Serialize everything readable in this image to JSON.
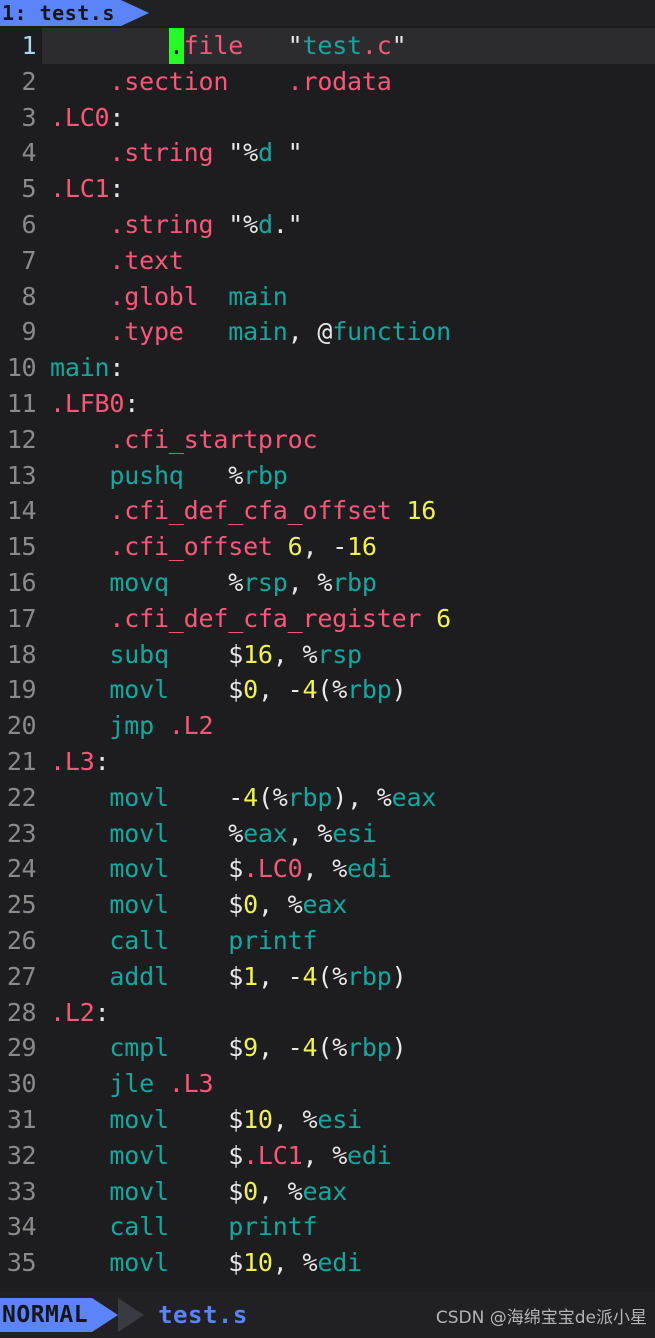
{
  "app": {
    "name": "vim-terminal-editor",
    "background": "#1d1d1f"
  },
  "colors": {
    "accent_blue": "#5c84fa",
    "directive_pink": "#f8567a",
    "identifier_teal": "#12a8a0",
    "number_yellow": "#f2f24f",
    "punctuation_white": "#e8e8e8",
    "cursor_green": "#27fb27",
    "linenr_gray": "#8a8a8a",
    "current_linenr": "#a9d8ef",
    "cursorline_bg": "#2c2c2e",
    "statusbar_bg": "#212125",
    "arrow_dark": "#3a3a42"
  },
  "tabline": {
    "tabs": [
      {
        "label": "1: test.s",
        "active": true
      }
    ]
  },
  "statusline": {
    "mode": "NORMAL",
    "filename": "test.s",
    "watermark": "CSDN @海绵宝宝de派小星"
  },
  "editor": {
    "cursor": {
      "line": 1,
      "column": 9,
      "char": "."
    },
    "first_visible_line": 1,
    "last_visible_line": 35,
    "lines": [
      {
        "num": "1",
        "current": true,
        "tokens": [
          {
            "t": "        ",
            "c": "pun"
          },
          {
            "t": ".",
            "c": "cursor"
          },
          {
            "t": "file",
            "c": "dir"
          },
          {
            "t": "   ",
            "c": "pun"
          },
          {
            "t": "\"",
            "c": "pun"
          },
          {
            "t": "test",
            "c": "str"
          },
          {
            "t": ".c",
            "c": "dir"
          },
          {
            "t": "\"",
            "c": "pun"
          }
        ]
      },
      {
        "num": "2",
        "current": false,
        "tokens": [
          {
            "t": "    ",
            "c": "pun"
          },
          {
            "t": ".section",
            "c": "dir"
          },
          {
            "t": "    ",
            "c": "pun"
          },
          {
            "t": ".rodata",
            "c": "dir"
          }
        ]
      },
      {
        "num": "3",
        "current": false,
        "tokens": [
          {
            "t": ".LC0",
            "c": "dir"
          },
          {
            "t": ":",
            "c": "pun"
          }
        ]
      },
      {
        "num": "4",
        "current": false,
        "tokens": [
          {
            "t": "    ",
            "c": "pun"
          },
          {
            "t": ".string",
            "c": "dir"
          },
          {
            "t": " ",
            "c": "pun"
          },
          {
            "t": "\"",
            "c": "pun"
          },
          {
            "t": "%",
            "c": "pun"
          },
          {
            "t": "d",
            "c": "str"
          },
          {
            "t": " \"",
            "c": "pun"
          }
        ]
      },
      {
        "num": "5",
        "current": false,
        "tokens": [
          {
            "t": ".LC1",
            "c": "dir"
          },
          {
            "t": ":",
            "c": "pun"
          }
        ]
      },
      {
        "num": "6",
        "current": false,
        "tokens": [
          {
            "t": "    ",
            "c": "pun"
          },
          {
            "t": ".string",
            "c": "dir"
          },
          {
            "t": " ",
            "c": "pun"
          },
          {
            "t": "\"",
            "c": "pun"
          },
          {
            "t": "%",
            "c": "pun"
          },
          {
            "t": "d",
            "c": "str"
          },
          {
            "t": ".\"",
            "c": "pun"
          }
        ]
      },
      {
        "num": "7",
        "current": false,
        "tokens": [
          {
            "t": "    ",
            "c": "pun"
          },
          {
            "t": ".text",
            "c": "dir"
          }
        ]
      },
      {
        "num": "8",
        "current": false,
        "tokens": [
          {
            "t": "    ",
            "c": "pun"
          },
          {
            "t": ".globl",
            "c": "dir"
          },
          {
            "t": "  ",
            "c": "pun"
          },
          {
            "t": "main",
            "c": "ins"
          }
        ]
      },
      {
        "num": "9",
        "current": false,
        "tokens": [
          {
            "t": "    ",
            "c": "pun"
          },
          {
            "t": ".type",
            "c": "dir"
          },
          {
            "t": "   ",
            "c": "pun"
          },
          {
            "t": "main",
            "c": "ins"
          },
          {
            "t": ", ",
            "c": "pun"
          },
          {
            "t": "@",
            "c": "pun"
          },
          {
            "t": "function",
            "c": "ins"
          }
        ]
      },
      {
        "num": "10",
        "current": false,
        "tokens": [
          {
            "t": "main",
            "c": "ins"
          },
          {
            "t": ":",
            "c": "pun"
          }
        ]
      },
      {
        "num": "11",
        "current": false,
        "tokens": [
          {
            "t": ".LFB0",
            "c": "dir"
          },
          {
            "t": ":",
            "c": "pun"
          }
        ]
      },
      {
        "num": "12",
        "current": false,
        "tokens": [
          {
            "t": "    ",
            "c": "pun"
          },
          {
            "t": ".cfi_startproc",
            "c": "dir"
          }
        ]
      },
      {
        "num": "13",
        "current": false,
        "tokens": [
          {
            "t": "    ",
            "c": "pun"
          },
          {
            "t": "pushq",
            "c": "ins"
          },
          {
            "t": "   ",
            "c": "pun"
          },
          {
            "t": "%",
            "c": "pun"
          },
          {
            "t": "rbp",
            "c": "ins"
          }
        ]
      },
      {
        "num": "14",
        "current": false,
        "tokens": [
          {
            "t": "    ",
            "c": "pun"
          },
          {
            "t": ".cfi_def_cfa_offset",
            "c": "dir"
          },
          {
            "t": " ",
            "c": "pun"
          },
          {
            "t": "16",
            "c": "num"
          }
        ]
      },
      {
        "num": "15",
        "current": false,
        "tokens": [
          {
            "t": "    ",
            "c": "pun"
          },
          {
            "t": ".cfi_offset",
            "c": "dir"
          },
          {
            "t": " ",
            "c": "pun"
          },
          {
            "t": "6",
            "c": "num"
          },
          {
            "t": ", -",
            "c": "pun"
          },
          {
            "t": "16",
            "c": "num"
          }
        ]
      },
      {
        "num": "16",
        "current": false,
        "tokens": [
          {
            "t": "    ",
            "c": "pun"
          },
          {
            "t": "movq",
            "c": "ins"
          },
          {
            "t": "    ",
            "c": "pun"
          },
          {
            "t": "%",
            "c": "pun"
          },
          {
            "t": "rsp",
            "c": "ins"
          },
          {
            "t": ", ",
            "c": "pun"
          },
          {
            "t": "%",
            "c": "pun"
          },
          {
            "t": "rbp",
            "c": "ins"
          }
        ]
      },
      {
        "num": "17",
        "current": false,
        "tokens": [
          {
            "t": "    ",
            "c": "pun"
          },
          {
            "t": ".cfi_def_cfa_register",
            "c": "dir"
          },
          {
            "t": " ",
            "c": "pun"
          },
          {
            "t": "6",
            "c": "num"
          }
        ]
      },
      {
        "num": "18",
        "current": false,
        "tokens": [
          {
            "t": "    ",
            "c": "pun"
          },
          {
            "t": "subq",
            "c": "ins"
          },
          {
            "t": "    ",
            "c": "pun"
          },
          {
            "t": "$",
            "c": "pun"
          },
          {
            "t": "16",
            "c": "num"
          },
          {
            "t": ", ",
            "c": "pun"
          },
          {
            "t": "%",
            "c": "pun"
          },
          {
            "t": "rsp",
            "c": "ins"
          }
        ]
      },
      {
        "num": "19",
        "current": false,
        "tokens": [
          {
            "t": "    ",
            "c": "pun"
          },
          {
            "t": "movl",
            "c": "ins"
          },
          {
            "t": "    ",
            "c": "pun"
          },
          {
            "t": "$",
            "c": "pun"
          },
          {
            "t": "0",
            "c": "num"
          },
          {
            "t": ", -",
            "c": "pun"
          },
          {
            "t": "4",
            "c": "num"
          },
          {
            "t": "(",
            "c": "pun"
          },
          {
            "t": "%",
            "c": "pun"
          },
          {
            "t": "rbp",
            "c": "ins"
          },
          {
            "t": ")",
            "c": "pun"
          }
        ]
      },
      {
        "num": "20",
        "current": false,
        "tokens": [
          {
            "t": "    ",
            "c": "pun"
          },
          {
            "t": "jmp",
            "c": "ins"
          },
          {
            "t": " ",
            "c": "pun"
          },
          {
            "t": ".L2",
            "c": "dir"
          }
        ]
      },
      {
        "num": "21",
        "current": false,
        "tokens": [
          {
            "t": ".L3",
            "c": "dir"
          },
          {
            "t": ":",
            "c": "pun"
          }
        ]
      },
      {
        "num": "22",
        "current": false,
        "tokens": [
          {
            "t": "    ",
            "c": "pun"
          },
          {
            "t": "movl",
            "c": "ins"
          },
          {
            "t": "    ",
            "c": "pun"
          },
          {
            "t": "-",
            "c": "pun"
          },
          {
            "t": "4",
            "c": "num"
          },
          {
            "t": "(",
            "c": "pun"
          },
          {
            "t": "%",
            "c": "pun"
          },
          {
            "t": "rbp",
            "c": "ins"
          },
          {
            "t": "), ",
            "c": "pun"
          },
          {
            "t": "%",
            "c": "pun"
          },
          {
            "t": "eax",
            "c": "ins"
          }
        ]
      },
      {
        "num": "23",
        "current": false,
        "tokens": [
          {
            "t": "    ",
            "c": "pun"
          },
          {
            "t": "movl",
            "c": "ins"
          },
          {
            "t": "    ",
            "c": "pun"
          },
          {
            "t": "%",
            "c": "pun"
          },
          {
            "t": "eax",
            "c": "ins"
          },
          {
            "t": ", ",
            "c": "pun"
          },
          {
            "t": "%",
            "c": "pun"
          },
          {
            "t": "esi",
            "c": "ins"
          }
        ]
      },
      {
        "num": "24",
        "current": false,
        "tokens": [
          {
            "t": "    ",
            "c": "pun"
          },
          {
            "t": "movl",
            "c": "ins"
          },
          {
            "t": "    ",
            "c": "pun"
          },
          {
            "t": "$",
            "c": "pun"
          },
          {
            "t": ".LC0",
            "c": "dir"
          },
          {
            "t": ", ",
            "c": "pun"
          },
          {
            "t": "%",
            "c": "pun"
          },
          {
            "t": "edi",
            "c": "ins"
          }
        ]
      },
      {
        "num": "25",
        "current": false,
        "tokens": [
          {
            "t": "    ",
            "c": "pun"
          },
          {
            "t": "movl",
            "c": "ins"
          },
          {
            "t": "    ",
            "c": "pun"
          },
          {
            "t": "$",
            "c": "pun"
          },
          {
            "t": "0",
            "c": "num"
          },
          {
            "t": ", ",
            "c": "pun"
          },
          {
            "t": "%",
            "c": "pun"
          },
          {
            "t": "eax",
            "c": "ins"
          }
        ]
      },
      {
        "num": "26",
        "current": false,
        "tokens": [
          {
            "t": "    ",
            "c": "pun"
          },
          {
            "t": "call",
            "c": "ins"
          },
          {
            "t": "    ",
            "c": "pun"
          },
          {
            "t": "printf",
            "c": "ins"
          }
        ]
      },
      {
        "num": "27",
        "current": false,
        "tokens": [
          {
            "t": "    ",
            "c": "pun"
          },
          {
            "t": "addl",
            "c": "ins"
          },
          {
            "t": "    ",
            "c": "pun"
          },
          {
            "t": "$",
            "c": "pun"
          },
          {
            "t": "1",
            "c": "num"
          },
          {
            "t": ", -",
            "c": "pun"
          },
          {
            "t": "4",
            "c": "num"
          },
          {
            "t": "(",
            "c": "pun"
          },
          {
            "t": "%",
            "c": "pun"
          },
          {
            "t": "rbp",
            "c": "ins"
          },
          {
            "t": ")",
            "c": "pun"
          }
        ]
      },
      {
        "num": "28",
        "current": false,
        "tokens": [
          {
            "t": ".L2",
            "c": "dir"
          },
          {
            "t": ":",
            "c": "pun"
          }
        ]
      },
      {
        "num": "29",
        "current": false,
        "tokens": [
          {
            "t": "    ",
            "c": "pun"
          },
          {
            "t": "cmpl",
            "c": "ins"
          },
          {
            "t": "    ",
            "c": "pun"
          },
          {
            "t": "$",
            "c": "pun"
          },
          {
            "t": "9",
            "c": "num"
          },
          {
            "t": ", -",
            "c": "pun"
          },
          {
            "t": "4",
            "c": "num"
          },
          {
            "t": "(",
            "c": "pun"
          },
          {
            "t": "%",
            "c": "pun"
          },
          {
            "t": "rbp",
            "c": "ins"
          },
          {
            "t": ")",
            "c": "pun"
          }
        ]
      },
      {
        "num": "30",
        "current": false,
        "tokens": [
          {
            "t": "    ",
            "c": "pun"
          },
          {
            "t": "jle",
            "c": "ins"
          },
          {
            "t": " ",
            "c": "pun"
          },
          {
            "t": ".L3",
            "c": "dir"
          }
        ]
      },
      {
        "num": "31",
        "current": false,
        "tokens": [
          {
            "t": "    ",
            "c": "pun"
          },
          {
            "t": "movl",
            "c": "ins"
          },
          {
            "t": "    ",
            "c": "pun"
          },
          {
            "t": "$",
            "c": "pun"
          },
          {
            "t": "10",
            "c": "num"
          },
          {
            "t": ", ",
            "c": "pun"
          },
          {
            "t": "%",
            "c": "pun"
          },
          {
            "t": "esi",
            "c": "ins"
          }
        ]
      },
      {
        "num": "32",
        "current": false,
        "tokens": [
          {
            "t": "    ",
            "c": "pun"
          },
          {
            "t": "movl",
            "c": "ins"
          },
          {
            "t": "    ",
            "c": "pun"
          },
          {
            "t": "$",
            "c": "pun"
          },
          {
            "t": ".LC1",
            "c": "dir"
          },
          {
            "t": ", ",
            "c": "pun"
          },
          {
            "t": "%",
            "c": "pun"
          },
          {
            "t": "edi",
            "c": "ins"
          }
        ]
      },
      {
        "num": "33",
        "current": false,
        "tokens": [
          {
            "t": "    ",
            "c": "pun"
          },
          {
            "t": "movl",
            "c": "ins"
          },
          {
            "t": "    ",
            "c": "pun"
          },
          {
            "t": "$",
            "c": "pun"
          },
          {
            "t": "0",
            "c": "num"
          },
          {
            "t": ", ",
            "c": "pun"
          },
          {
            "t": "%",
            "c": "pun"
          },
          {
            "t": "eax",
            "c": "ins"
          }
        ]
      },
      {
        "num": "34",
        "current": false,
        "tokens": [
          {
            "t": "    ",
            "c": "pun"
          },
          {
            "t": "call",
            "c": "ins"
          },
          {
            "t": "    ",
            "c": "pun"
          },
          {
            "t": "printf",
            "c": "ins"
          }
        ]
      },
      {
        "num": "35",
        "current": false,
        "tokens": [
          {
            "t": "    ",
            "c": "pun"
          },
          {
            "t": "movl",
            "c": "ins"
          },
          {
            "t": "    ",
            "c": "pun"
          },
          {
            "t": "$",
            "c": "pun"
          },
          {
            "t": "10",
            "c": "num"
          },
          {
            "t": ", ",
            "c": "pun"
          },
          {
            "t": "%",
            "c": "pun"
          },
          {
            "t": "edi",
            "c": "ins"
          }
        ]
      }
    ]
  }
}
